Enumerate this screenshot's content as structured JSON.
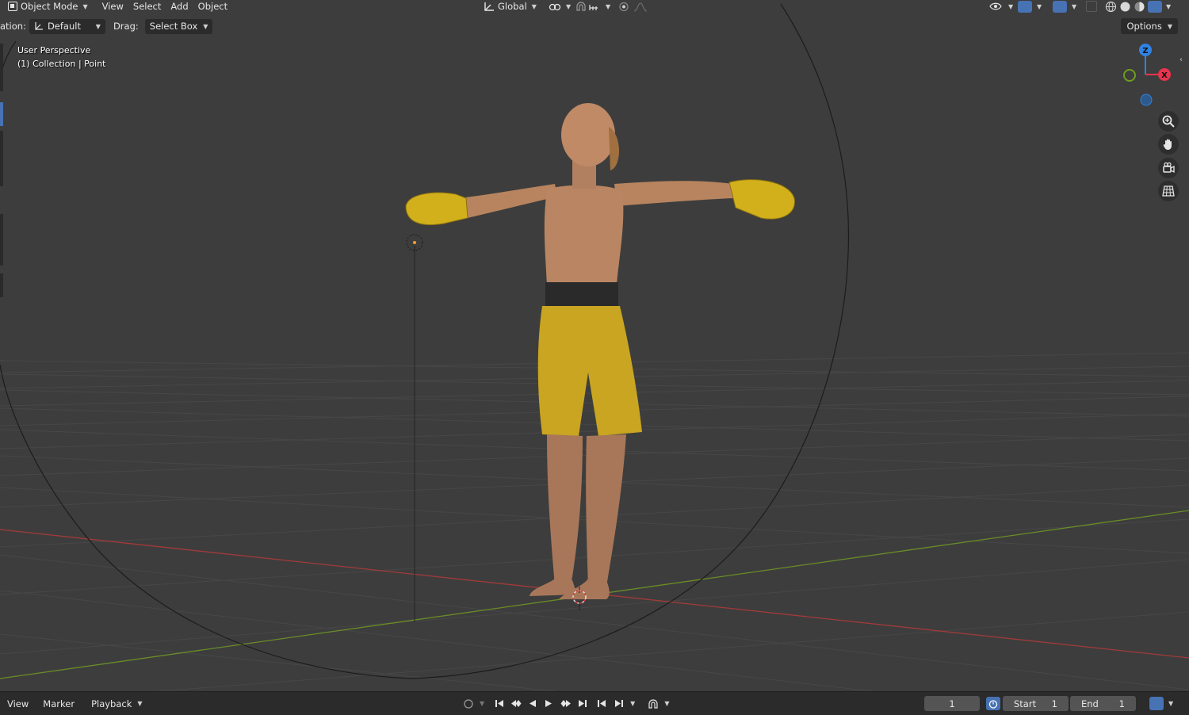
{
  "header": {
    "mode_label": "Object Mode",
    "menu": [
      "View",
      "Select",
      "Add",
      "Object"
    ],
    "transform_orientation": "Global"
  },
  "tool_settings": {
    "orientation_label": "ation:",
    "orientation_value": "Default",
    "drag_label": "Drag:",
    "drag_value": "Select Box",
    "options_label": "Options"
  },
  "viewport": {
    "perspective_label": "User Perspective",
    "collection_label": "(1) Collection | Point"
  },
  "gizmo": {
    "z_label": "Z",
    "x_label": "X",
    "z_color": "#2f83e3",
    "x_color": "#e8344e",
    "y_color": "#6f9d1d"
  },
  "timeline": {
    "menu": [
      "View",
      "Marker",
      "Playback"
    ],
    "current_frame": "1",
    "start_label": "Start",
    "start_value": "1",
    "end_label": "End",
    "end_value": "1"
  },
  "colors": {
    "viewport_bg": "#3d3d3d",
    "axis_x": "#b23a3a",
    "axis_y": "#6b8a2a",
    "gloves": "#d4b21e",
    "shorts": "#c9a521",
    "skin": "#b98563"
  }
}
